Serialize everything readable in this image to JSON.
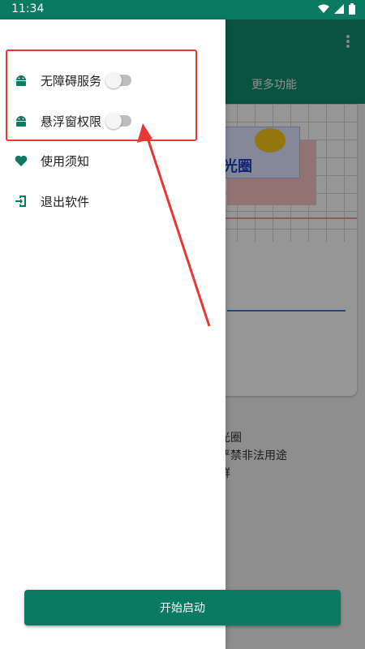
{
  "status_bar": {
    "time": "11:34"
  },
  "app": {
    "tab_more": "更多功能",
    "card_text": "光圈",
    "notes": [
      "光圈",
      "严禁非法用途",
      "群"
    ]
  },
  "drawer": {
    "items": [
      {
        "label": "无障碍服务",
        "icon": "android-icon",
        "toggle": false
      },
      {
        "label": "悬浮窗权限",
        "icon": "android-icon",
        "toggle": false
      },
      {
        "label": "使用须知",
        "icon": "heart-icon"
      },
      {
        "label": "退出软件",
        "icon": "exit-icon"
      }
    ]
  },
  "start_button": {
    "label": "开始启动"
  },
  "colors": {
    "primary": "#0b7a62",
    "highlight": "#e53935"
  }
}
